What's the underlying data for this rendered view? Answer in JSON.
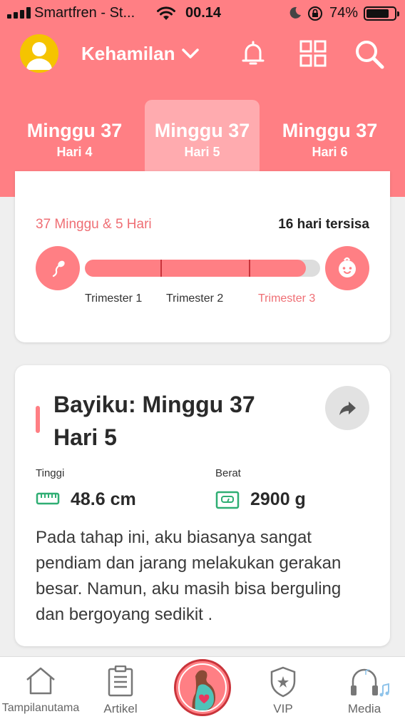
{
  "status_bar": {
    "carrier": "Smartfren - St...",
    "time": "00.14",
    "battery_percent": "74%",
    "battery_level": 0.74
  },
  "header": {
    "title": "Kehamilan",
    "icons": [
      "user-avatar-icon",
      "chevron-down-icon",
      "bell-icon",
      "grid-icon",
      "search-icon"
    ]
  },
  "day_tabs": [
    {
      "week": "Minggu 37",
      "day": "Hari 4",
      "active": false
    },
    {
      "week": "Minggu 37",
      "day": "Hari 5",
      "active": true
    },
    {
      "week": "Minggu 37",
      "day": "Hari 6",
      "active": false
    }
  ],
  "progress": {
    "elapsed_label": "37 Minggu & 5 Hari",
    "remaining_label": "16 hari tersisa",
    "fraction_complete": 0.94,
    "trimesters": [
      "Trimester 1",
      "Trimester 2",
      "Trimester 3"
    ],
    "active_trimester": 3
  },
  "baby": {
    "title_line1": "Bayiku: Minggu 37",
    "title_line2": "Hari 5",
    "height_label": "Tinggi",
    "height_value": "48.6 cm",
    "weight_label": "Berat",
    "weight_value": "2900 g",
    "description": "Pada tahap ini, aku biasanya sangat pendiam dan jarang melakukan gerakan besar. Namun, aku masih bisa berguling dan bergoyang sedikit ."
  },
  "bottom_nav": {
    "home": "Tampilanutama",
    "articles": "Artikel",
    "vip": "VIP",
    "media": "Media"
  },
  "colors": {
    "primary": "#ff7f84",
    "accent_dark": "#c9343b",
    "measure_icon": "#2fae73"
  }
}
